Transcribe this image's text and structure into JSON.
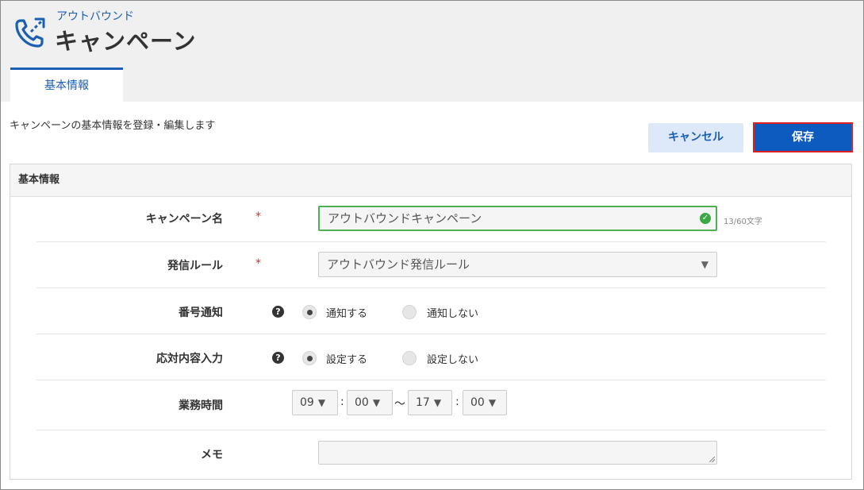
{
  "header": {
    "subtitle": "アウトバウンド",
    "title": "キャンペーン",
    "logo_icon": "phone-outbound-icon",
    "accent": "#1a5fb4"
  },
  "tabs": [
    {
      "label": "基本情報",
      "active": true
    }
  ],
  "description": "キャンペーンの基本情報を登録・編集します",
  "actions": {
    "cancel_label": "キャンセル",
    "save_label": "保存"
  },
  "section": {
    "title": "基本情報"
  },
  "form": {
    "campaign_name": {
      "label": "キャンペーン名",
      "required_mark": "*",
      "value": "アウトバウンドキャンペーン",
      "counter": "13/60文字"
    },
    "call_rule": {
      "label": "発信ルール",
      "required_mark": "*",
      "value": "アウトバウンド発信ルール"
    },
    "number_notify": {
      "label": "番号通知",
      "help": "?",
      "options": [
        "通知する",
        "通知しない"
      ],
      "selected": "通知する"
    },
    "response_input": {
      "label": "応対内容入力",
      "help": "?",
      "options": [
        "設定する",
        "設定しない"
      ],
      "selected": "設定する"
    },
    "business_hours": {
      "label": "業務時間",
      "start_hour": "09",
      "start_min": "00",
      "range_sep": "～",
      "end_hour": "17",
      "end_min": "00",
      "time_sep": ":"
    },
    "memo": {
      "label": "メモ",
      "value": ""
    }
  }
}
